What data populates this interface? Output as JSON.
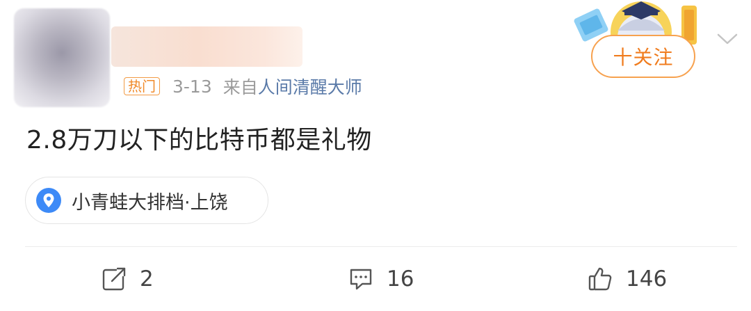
{
  "post": {
    "badge": "热门",
    "date": "3-13",
    "from_prefix": "来自",
    "source": "人间清醒大师",
    "text": "2.8万刀以下的比特币都是礼物",
    "location": "小青蛙大排档·上饶"
  },
  "header": {
    "follow_label": "十关注",
    "more_icon": "chevron-down-icon"
  },
  "actions": {
    "repost_count": "2",
    "comment_count": "16",
    "like_count": "146"
  },
  "colors": {
    "accent_orange": "#f07c1e",
    "link_blue": "#5a7aa8",
    "location_pin": "#3d8af7",
    "muted_gray": "#9a9a9a"
  }
}
